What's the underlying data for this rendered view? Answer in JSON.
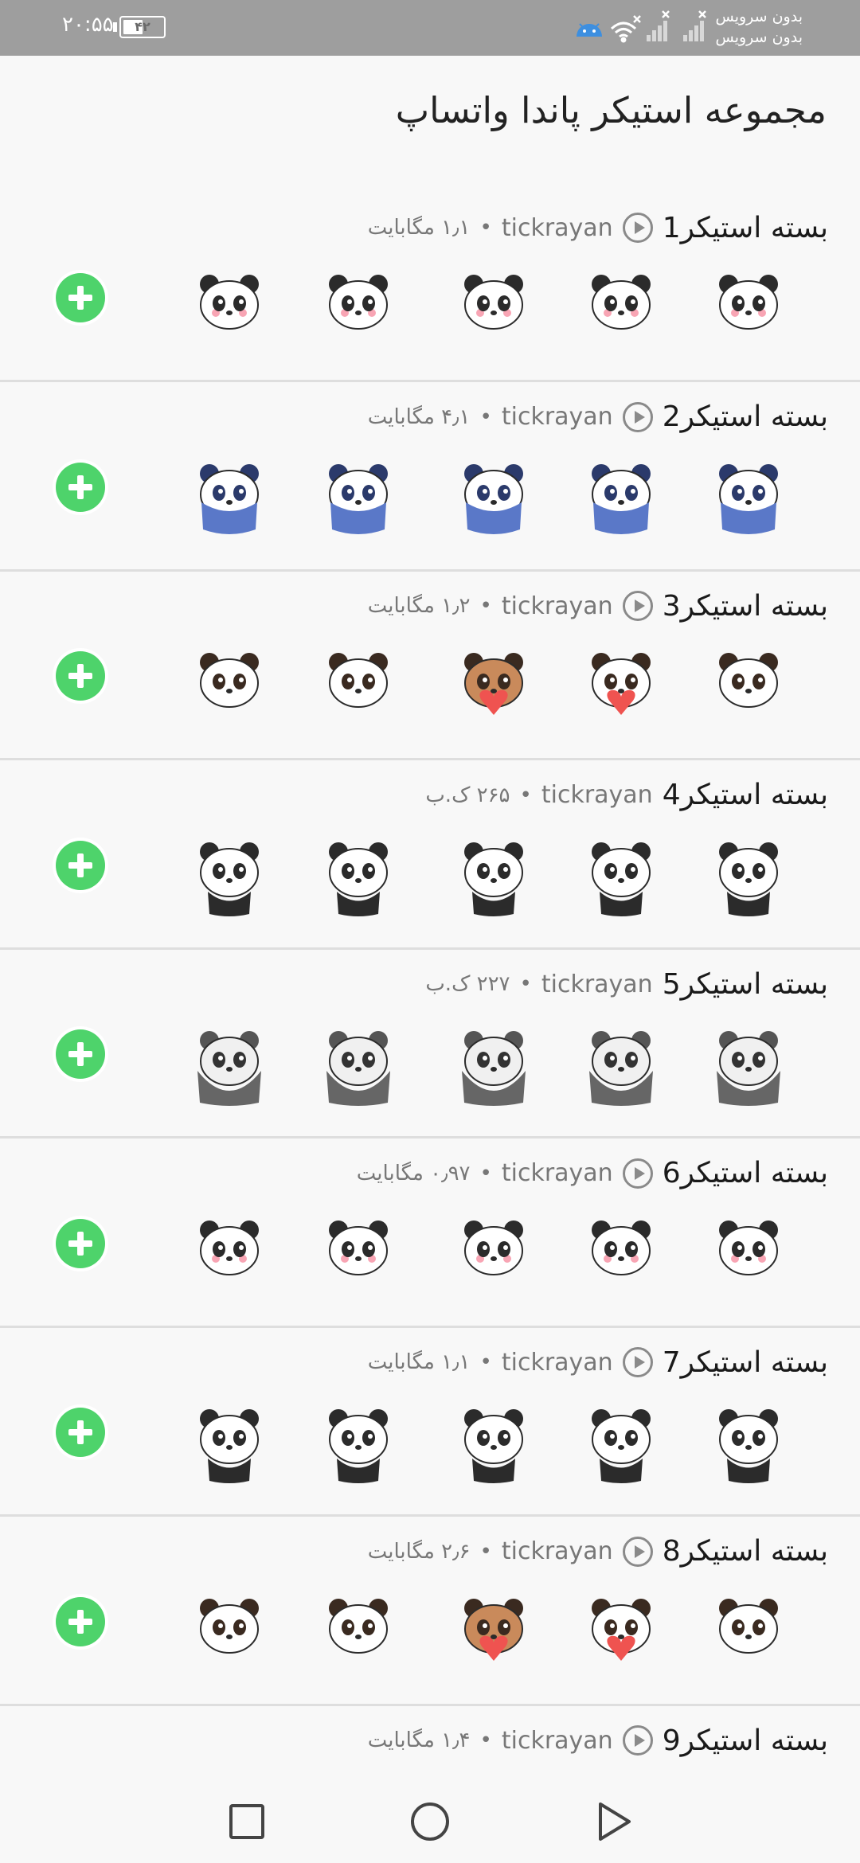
{
  "status_bar": {
    "time": "۲۰:۵۵",
    "battery": "۴۲",
    "carrier_1": "بدون سرویس",
    "carrier_2": "بدون سرویس"
  },
  "page": {
    "title": "مجموعه استیکر پاندا واتساپ"
  },
  "colors": {
    "add_button": "#4ed36b",
    "status_bar": "#9e9e9e",
    "divider": "#dedede"
  },
  "packs": [
    {
      "name": "بسته استیکر1",
      "author": "tickrayan",
      "size": "۱٫۱ مگابایت",
      "animated": true,
      "sticker_style": "chibi"
    },
    {
      "name": "بسته استیکر2",
      "author": "tickrayan",
      "size": "۴٫۱ مگابایت",
      "animated": true,
      "sticker_style": "blue-panda"
    },
    {
      "name": "بسته استیکر3",
      "author": "tickrayan",
      "size": "۱٫۲ مگابایت",
      "animated": true,
      "sticker_style": "milk-mocha"
    },
    {
      "name": "بسته استیکر4",
      "author": "tickrayan",
      "size": "۲۶۵ ک.ب",
      "animated": false,
      "sticker_style": "classic"
    },
    {
      "name": "بسته استیکر5",
      "author": "tickrayan",
      "size": "۲۲۷ ک.ب",
      "animated": false,
      "sticker_style": "bare-bear"
    },
    {
      "name": "بسته استیکر6",
      "author": "tickrayan",
      "size": "۰٫۹۷ مگابایت",
      "animated": true,
      "sticker_style": "chibi"
    },
    {
      "name": "بسته استیکر7",
      "author": "tickrayan",
      "size": "۱٫۱ مگابایت",
      "animated": true,
      "sticker_style": "classic"
    },
    {
      "name": "بسته استیکر8",
      "author": "tickrayan",
      "size": "۲٫۶ مگابایت",
      "animated": true,
      "sticker_style": "milk-mocha"
    },
    {
      "name": "بسته استیکر9",
      "author": "tickrayan",
      "size": "۱٫۴ مگابایت",
      "animated": true,
      "sticker_style": "none"
    }
  ],
  "icons": {
    "play": "play-icon",
    "add": "add-icon",
    "nav_recent": "square-icon",
    "nav_home": "circle-icon",
    "nav_back": "triangle-icon"
  }
}
